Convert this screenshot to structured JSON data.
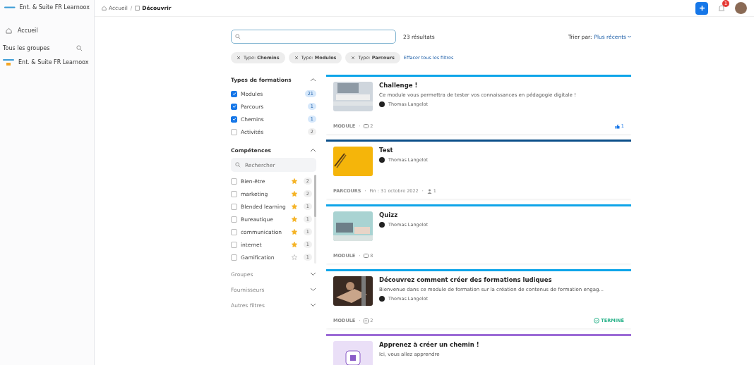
{
  "sidebar": {
    "workspace": "Ent. & Suite FR Learnoox",
    "nav": [
      {
        "label": "Accueil",
        "selected": false
      }
    ],
    "groups_title": "Tous les groupes",
    "groups": [
      {
        "label": "Ent. & Suite FR Learnoox"
      }
    ]
  },
  "breadcrumb": [
    {
      "label": "Accueil"
    },
    {
      "separator": "/",
      "label": "Découvrir"
    }
  ],
  "header": {
    "notifications": "1"
  },
  "search": {
    "results": "23 résultats"
  },
  "sort": {
    "label": "Trier par:",
    "value": "Plus récents"
  },
  "chips": [
    {
      "prefix": "Type:",
      "value": "Chemins"
    },
    {
      "prefix": "Type:",
      "value": "Modules"
    },
    {
      "prefix": "Type:",
      "value": "Parcours"
    }
  ],
  "clear_filters": "Effacer tous les filtres",
  "types": {
    "title": "Types de formations",
    "expanded": true,
    "items": [
      {
        "label": "Modules",
        "count": "21",
        "checked": true
      },
      {
        "label": "Parcours",
        "count": "1",
        "checked": true
      },
      {
        "label": "Chemins",
        "count": "1",
        "checked": true
      },
      {
        "label": "Activités",
        "count": "2",
        "checked": false
      }
    ]
  },
  "skills": {
    "title": "Compétences",
    "expanded": true,
    "placeholder": "Rechercher",
    "items": [
      {
        "label": "Bien-être",
        "count": "2",
        "checked": false,
        "starred": true
      },
      {
        "label": "marketing",
        "count": "2",
        "checked": false,
        "starred": true
      },
      {
        "label": "Blended learning",
        "count": "1",
        "checked": false,
        "starred": true
      },
      {
        "label": "Bureautique",
        "count": "1",
        "checked": false,
        "starred": true
      },
      {
        "label": "communication",
        "count": "1",
        "checked": false,
        "starred": true
      },
      {
        "label": "internet",
        "count": "1",
        "checked": false,
        "starred": true
      },
      {
        "label": "Gamification",
        "count": "1",
        "checked": false,
        "starred": false
      }
    ]
  },
  "collapsed_filters": [
    {
      "title": "Groupes",
      "expanded": false
    },
    {
      "title": "Fournisseurs",
      "expanded": false
    },
    {
      "title": "Autres filtres",
      "expanded": false
    }
  ],
  "cards": [
    {
      "title": "Challenge !",
      "description": "Ce module vous permettra de tester vos connaissances en pédagogie digitale !",
      "author": "Thomas Langelot",
      "type": "MODULE",
      "color": "#0ea5e9",
      "meta": [
        {
          "kind": "quiz",
          "separator": "·",
          "text": "2"
        }
      ],
      "likes": "1"
    },
    {
      "title": "Test",
      "author": "Thomas Langelot",
      "type": "PARCOURS",
      "color": "#0b4f8a",
      "meta": [
        {
          "kind": "date",
          "separator": "·",
          "text": "Fin : 31 octobre 2022"
        },
        {
          "kind": "people",
          "separator": "·",
          "text": "1"
        }
      ]
    },
    {
      "title": "Quizz",
      "author": "Thomas Langelot",
      "type": "MODULE",
      "color": "#0ea5e9",
      "meta": [
        {
          "kind": "quiz",
          "separator": "·",
          "text": "8"
        }
      ]
    },
    {
      "title": "Découvrez comment créer des formations ludiques",
      "description": "Bienvenue dans ce module de formation sur la création de contenus de formation engag...",
      "author": "Thomas Langelot",
      "type": "MODULE",
      "color": "#0ea5e9",
      "meta": [
        {
          "kind": "activity",
          "separator": "·",
          "text": "2"
        }
      ],
      "status": "TERMINÉ"
    },
    {
      "title": "Apprenez à créer un chemin !",
      "description": "Ici, vous allez apprendre",
      "color": "#9b6bd6"
    }
  ]
}
